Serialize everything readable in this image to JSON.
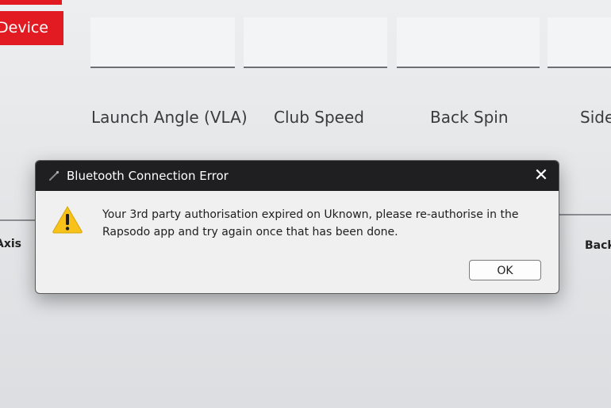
{
  "app": {
    "device_button_label": "Device",
    "metrics": [
      {
        "label": "Launch Angle (VLA)"
      },
      {
        "label": "Club Speed"
      },
      {
        "label": "Back Spin"
      },
      {
        "label": "Side"
      }
    ],
    "left_partial_label": "Axis",
    "right_partial_label": "Back"
  },
  "dialog": {
    "title": "Bluetooth Connection Error",
    "message": "Your 3rd party authorisation expired on Uknown, please re-authorise in the Rapsodo app and try again once that has been done.",
    "ok_label": "OK",
    "close_symbol": "✕",
    "icons": {
      "title": "app-icon",
      "body": "warning-icon",
      "close": "close-icon"
    }
  },
  "colors": {
    "accent_red": "#e21b22",
    "titlebar": "#1f1f21",
    "warning_yellow": "#f7c21a"
  }
}
